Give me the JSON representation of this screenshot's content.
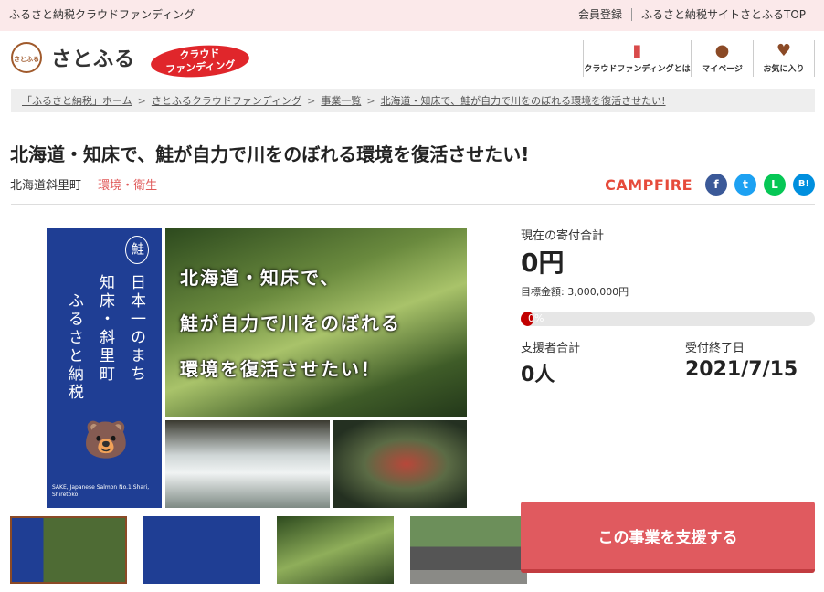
{
  "topbar": {
    "site_title": "ふるさと納税クラウドファンディング",
    "links": [
      "会員登録",
      "ふるさと納税サイトさとふるTOP"
    ]
  },
  "header": {
    "logo_mark": "さとふる",
    "logo_text": "さとふる",
    "badge_line1": "クラウド",
    "badge_line2": "ファンディング",
    "nav": [
      {
        "label": "クラウドファンディングとは",
        "icon": "book-icon"
      },
      {
        "label": "マイページ",
        "icon": "person-icon"
      },
      {
        "label": "お気に入り",
        "icon": "heart-icon"
      }
    ]
  },
  "breadcrumb": [
    "「ふるさと納税」ホーム",
    "さとふるクラウドファンディング",
    "事業一覧",
    "北海道・知床で、鮭が自力で川をのぼれる環境を復活させたい!"
  ],
  "project": {
    "title": "北海道・知床で、鮭が自力で川をのぼれる環境を復活させたい!",
    "place": "北海道斜里町",
    "category": "環境・衛生"
  },
  "share": {
    "campfire": "CAMPFIRE",
    "buttons": [
      {
        "name": "facebook",
        "glyph": "f",
        "color": "#3b5998"
      },
      {
        "name": "twitter",
        "glyph": "t",
        "color": "#1da1f2"
      },
      {
        "name": "line",
        "glyph": "L",
        "color": "#06c755"
      },
      {
        "name": "hatena",
        "glyph": "B!",
        "color": "#008fde"
      }
    ]
  },
  "hero": {
    "kanji": "鮭",
    "line1": "日本一のまち",
    "line2": "知床・斜里町",
    "line3": "ふるさと納税",
    "small_text": "SAKE, Japanese Salmon No.1 Shari, Shiretoko",
    "overlay": [
      "北海道・知床で、",
      "鮭が自力で川をのぼれる",
      "環境を復活させたい！"
    ]
  },
  "stats": {
    "total_label": "現在の寄付合計",
    "total_value": "0円",
    "goal_text": "目標金額: 3,000,000円",
    "progress_text": "0%",
    "progress_fraction": 0,
    "supporters_label": "支援者合計",
    "supporters_value": "0人",
    "deadline_label": "受付終了日",
    "deadline_value": "2021/7/15"
  },
  "cta": {
    "label": "この事業を支援する"
  }
}
